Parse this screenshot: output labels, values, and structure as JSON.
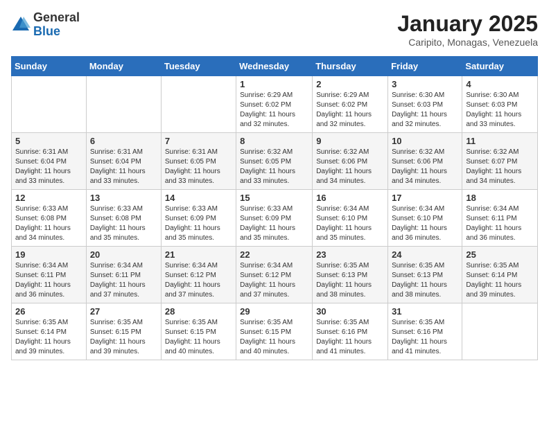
{
  "header": {
    "logo_general": "General",
    "logo_blue": "Blue",
    "month_title": "January 2025",
    "location": "Caripito, Monagas, Venezuela"
  },
  "days_of_week": [
    "Sunday",
    "Monday",
    "Tuesday",
    "Wednesday",
    "Thursday",
    "Friday",
    "Saturday"
  ],
  "weeks": [
    [
      {
        "day": "",
        "sunrise": "",
        "sunset": "",
        "daylight": ""
      },
      {
        "day": "",
        "sunrise": "",
        "sunset": "",
        "daylight": ""
      },
      {
        "day": "",
        "sunrise": "",
        "sunset": "",
        "daylight": ""
      },
      {
        "day": "1",
        "sunrise": "Sunrise: 6:29 AM",
        "sunset": "Sunset: 6:02 PM",
        "daylight": "Daylight: 11 hours and 32 minutes."
      },
      {
        "day": "2",
        "sunrise": "Sunrise: 6:29 AM",
        "sunset": "Sunset: 6:02 PM",
        "daylight": "Daylight: 11 hours and 32 minutes."
      },
      {
        "day": "3",
        "sunrise": "Sunrise: 6:30 AM",
        "sunset": "Sunset: 6:03 PM",
        "daylight": "Daylight: 11 hours and 32 minutes."
      },
      {
        "day": "4",
        "sunrise": "Sunrise: 6:30 AM",
        "sunset": "Sunset: 6:03 PM",
        "daylight": "Daylight: 11 hours and 33 minutes."
      }
    ],
    [
      {
        "day": "5",
        "sunrise": "Sunrise: 6:31 AM",
        "sunset": "Sunset: 6:04 PM",
        "daylight": "Daylight: 11 hours and 33 minutes."
      },
      {
        "day": "6",
        "sunrise": "Sunrise: 6:31 AM",
        "sunset": "Sunset: 6:04 PM",
        "daylight": "Daylight: 11 hours and 33 minutes."
      },
      {
        "day": "7",
        "sunrise": "Sunrise: 6:31 AM",
        "sunset": "Sunset: 6:05 PM",
        "daylight": "Daylight: 11 hours and 33 minutes."
      },
      {
        "day": "8",
        "sunrise": "Sunrise: 6:32 AM",
        "sunset": "Sunset: 6:05 PM",
        "daylight": "Daylight: 11 hours and 33 minutes."
      },
      {
        "day": "9",
        "sunrise": "Sunrise: 6:32 AM",
        "sunset": "Sunset: 6:06 PM",
        "daylight": "Daylight: 11 hours and 34 minutes."
      },
      {
        "day": "10",
        "sunrise": "Sunrise: 6:32 AM",
        "sunset": "Sunset: 6:06 PM",
        "daylight": "Daylight: 11 hours and 34 minutes."
      },
      {
        "day": "11",
        "sunrise": "Sunrise: 6:32 AM",
        "sunset": "Sunset: 6:07 PM",
        "daylight": "Daylight: 11 hours and 34 minutes."
      }
    ],
    [
      {
        "day": "12",
        "sunrise": "Sunrise: 6:33 AM",
        "sunset": "Sunset: 6:08 PM",
        "daylight": "Daylight: 11 hours and 34 minutes."
      },
      {
        "day": "13",
        "sunrise": "Sunrise: 6:33 AM",
        "sunset": "Sunset: 6:08 PM",
        "daylight": "Daylight: 11 hours and 35 minutes."
      },
      {
        "day": "14",
        "sunrise": "Sunrise: 6:33 AM",
        "sunset": "Sunset: 6:09 PM",
        "daylight": "Daylight: 11 hours and 35 minutes."
      },
      {
        "day": "15",
        "sunrise": "Sunrise: 6:33 AM",
        "sunset": "Sunset: 6:09 PM",
        "daylight": "Daylight: 11 hours and 35 minutes."
      },
      {
        "day": "16",
        "sunrise": "Sunrise: 6:34 AM",
        "sunset": "Sunset: 6:10 PM",
        "daylight": "Daylight: 11 hours and 35 minutes."
      },
      {
        "day": "17",
        "sunrise": "Sunrise: 6:34 AM",
        "sunset": "Sunset: 6:10 PM",
        "daylight": "Daylight: 11 hours and 36 minutes."
      },
      {
        "day": "18",
        "sunrise": "Sunrise: 6:34 AM",
        "sunset": "Sunset: 6:11 PM",
        "daylight": "Daylight: 11 hours and 36 minutes."
      }
    ],
    [
      {
        "day": "19",
        "sunrise": "Sunrise: 6:34 AM",
        "sunset": "Sunset: 6:11 PM",
        "daylight": "Daylight: 11 hours and 36 minutes."
      },
      {
        "day": "20",
        "sunrise": "Sunrise: 6:34 AM",
        "sunset": "Sunset: 6:11 PM",
        "daylight": "Daylight: 11 hours and 37 minutes."
      },
      {
        "day": "21",
        "sunrise": "Sunrise: 6:34 AM",
        "sunset": "Sunset: 6:12 PM",
        "daylight": "Daylight: 11 hours and 37 minutes."
      },
      {
        "day": "22",
        "sunrise": "Sunrise: 6:34 AM",
        "sunset": "Sunset: 6:12 PM",
        "daylight": "Daylight: 11 hours and 37 minutes."
      },
      {
        "day": "23",
        "sunrise": "Sunrise: 6:35 AM",
        "sunset": "Sunset: 6:13 PM",
        "daylight": "Daylight: 11 hours and 38 minutes."
      },
      {
        "day": "24",
        "sunrise": "Sunrise: 6:35 AM",
        "sunset": "Sunset: 6:13 PM",
        "daylight": "Daylight: 11 hours and 38 minutes."
      },
      {
        "day": "25",
        "sunrise": "Sunrise: 6:35 AM",
        "sunset": "Sunset: 6:14 PM",
        "daylight": "Daylight: 11 hours and 39 minutes."
      }
    ],
    [
      {
        "day": "26",
        "sunrise": "Sunrise: 6:35 AM",
        "sunset": "Sunset: 6:14 PM",
        "daylight": "Daylight: 11 hours and 39 minutes."
      },
      {
        "day": "27",
        "sunrise": "Sunrise: 6:35 AM",
        "sunset": "Sunset: 6:15 PM",
        "daylight": "Daylight: 11 hours and 39 minutes."
      },
      {
        "day": "28",
        "sunrise": "Sunrise: 6:35 AM",
        "sunset": "Sunset: 6:15 PM",
        "daylight": "Daylight: 11 hours and 40 minutes."
      },
      {
        "day": "29",
        "sunrise": "Sunrise: 6:35 AM",
        "sunset": "Sunset: 6:15 PM",
        "daylight": "Daylight: 11 hours and 40 minutes."
      },
      {
        "day": "30",
        "sunrise": "Sunrise: 6:35 AM",
        "sunset": "Sunset: 6:16 PM",
        "daylight": "Daylight: 11 hours and 41 minutes."
      },
      {
        "day": "31",
        "sunrise": "Sunrise: 6:35 AM",
        "sunset": "Sunset: 6:16 PM",
        "daylight": "Daylight: 11 hours and 41 minutes."
      },
      {
        "day": "",
        "sunrise": "",
        "sunset": "",
        "daylight": ""
      }
    ]
  ]
}
